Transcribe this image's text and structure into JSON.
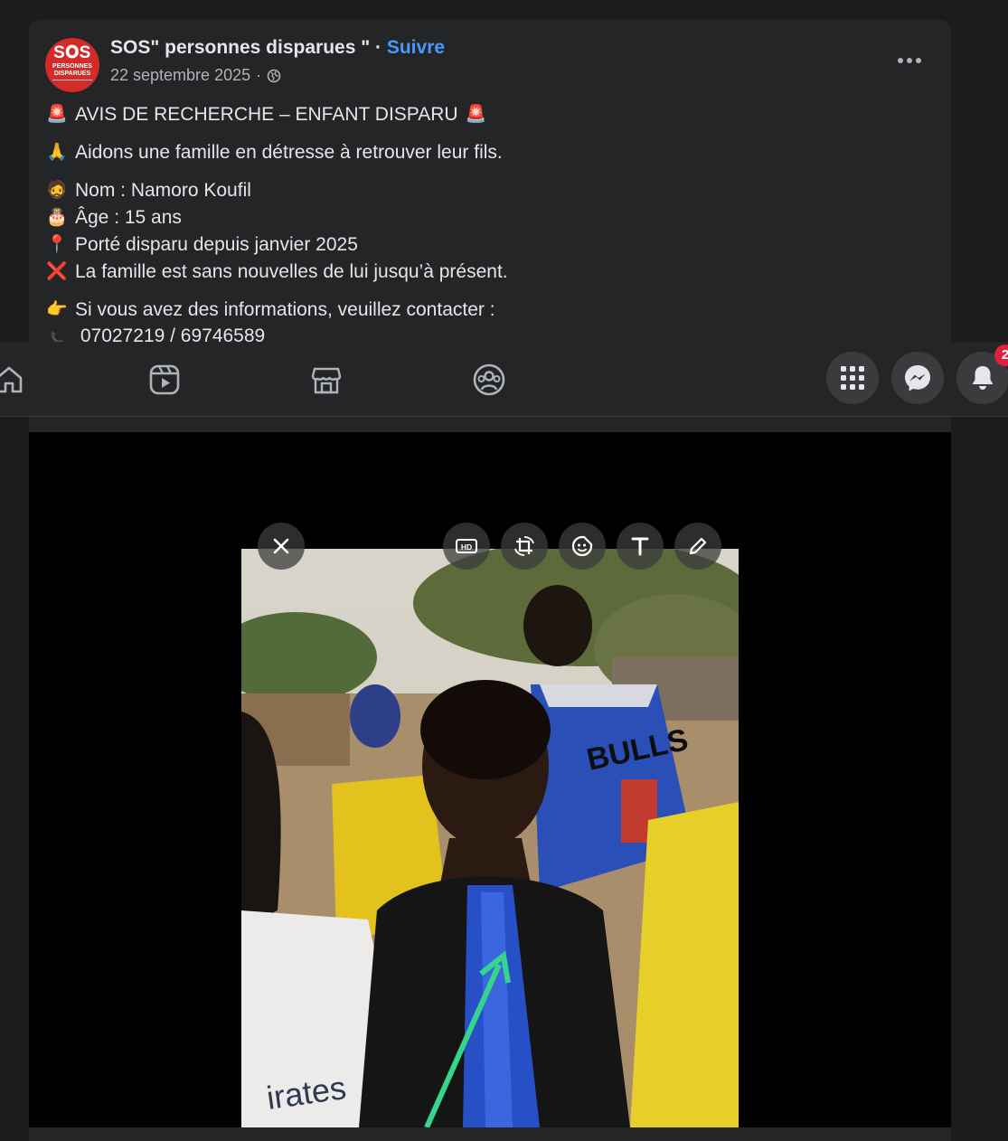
{
  "post": {
    "page_name": "SOS\" personnes disparues \"",
    "separator": " · ",
    "follow_label": "Suivre",
    "date": "22 septembre 2025",
    "date_separator": "·",
    "avatar_logo": {
      "top": "S𝐎S",
      "middle": "PERSONNES DISPARUES"
    },
    "lines": [
      {
        "emoji": "🚨",
        "text": "AVIS DE RECHERCHE – ENFANT DISPARU",
        "trail_emoji": "🚨"
      },
      {
        "emoji": "🙏",
        "text": "Aidons une famille en détresse à retrouver leur fils."
      },
      {
        "emoji": "🧔",
        "text": "Nom : Namoro Koufil"
      },
      {
        "emoji": "🎂",
        "text": "Âge : 15 ans"
      },
      {
        "emoji": "📍",
        "text": "Porté disparu depuis janvier 2025"
      },
      {
        "emoji": "❌",
        "text": "La famille est sans nouvelles de lui jusqu’à présent."
      },
      {
        "emoji": "👉",
        "text": "Si vous avez des informations, veuillez contacter :"
      },
      {
        "emoji": "📞",
        "text": "07027219 / 69746589"
      }
    ]
  },
  "navbar": {
    "notification_count": "2",
    "tabs": [
      "home-icon",
      "reels-icon",
      "marketplace-icon",
      "groups-icon"
    ],
    "actions": [
      "menu-grid-icon",
      "messenger-icon",
      "bell-icon"
    ]
  },
  "photo_toolbar": {
    "hd_label": "HD",
    "tools": [
      "close-icon",
      "hd-icon",
      "crop-rotate-icon",
      "sticker-icon",
      "text-icon",
      "pencil-icon"
    ]
  },
  "photo_jersey_text": "BULLS",
  "colors": {
    "background": "#1c1c1d",
    "card": "#242526",
    "text": "#e4e6eb",
    "secondary_text": "#b0b3b8",
    "accent": "#4599ff",
    "badge": "#e41e3f",
    "avatar_red": "#d42a2a"
  }
}
